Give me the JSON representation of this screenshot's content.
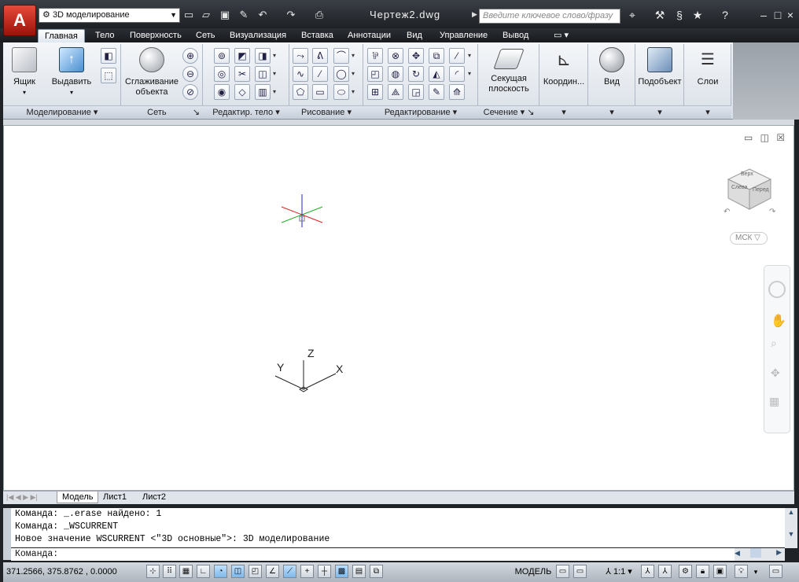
{
  "titlebar": {
    "app_logo": "A",
    "workspace": "3D моделирование",
    "document_title": "Чертеж2.dwg",
    "search_placeholder": "Введите ключевое слово/фразу",
    "win_min": "–",
    "win_max": "□",
    "win_close": "×"
  },
  "tabs": [
    "Главная",
    "Тело",
    "Поверхность",
    "Сеть",
    "Визуализация",
    "Вставка",
    "Аннотации",
    "Вид",
    "Управление",
    "Вывод"
  ],
  "ribbon": {
    "box_label": "Ящик",
    "extrude_label": "Выдавить",
    "smooth_label_1": "Сглаживание",
    "smooth_label_2": "объекта",
    "section_label_1": "Секущая",
    "section_label_2": "плоскость",
    "coords_label": "Координ...",
    "view_label": "Вид",
    "subobject_label": "Подобъект",
    "layers_label": "Слои",
    "panels": {
      "modeling": "Моделирование",
      "mesh": "Сеть",
      "solid_edit": "Редактир. тело",
      "draw": "Рисование",
      "modify": "Редактирование",
      "section": "Сечение"
    }
  },
  "viewport": {
    "viewcube_top": "Верх",
    "viewcube_left": "Слева",
    "viewcube_front": "Перед",
    "ucs_menu": "МСК",
    "axis_x": "X",
    "axis_y": "Y",
    "axis_z": "Z"
  },
  "layout_tabs": [
    "Модель",
    "Лист1",
    "Лист2"
  ],
  "command": {
    "line1": "Команда:  _.erase найдено: 1",
    "line2": "Команда:  _WSCURRENT",
    "line3": "Новое значение WSCURRENT <\"3D основные\">: 3D моделирование",
    "prompt": "Команда:"
  },
  "status": {
    "coords": "371.2566, 375.8762 , 0.0000",
    "model": "МОДЕЛЬ",
    "scale": "1:1"
  }
}
